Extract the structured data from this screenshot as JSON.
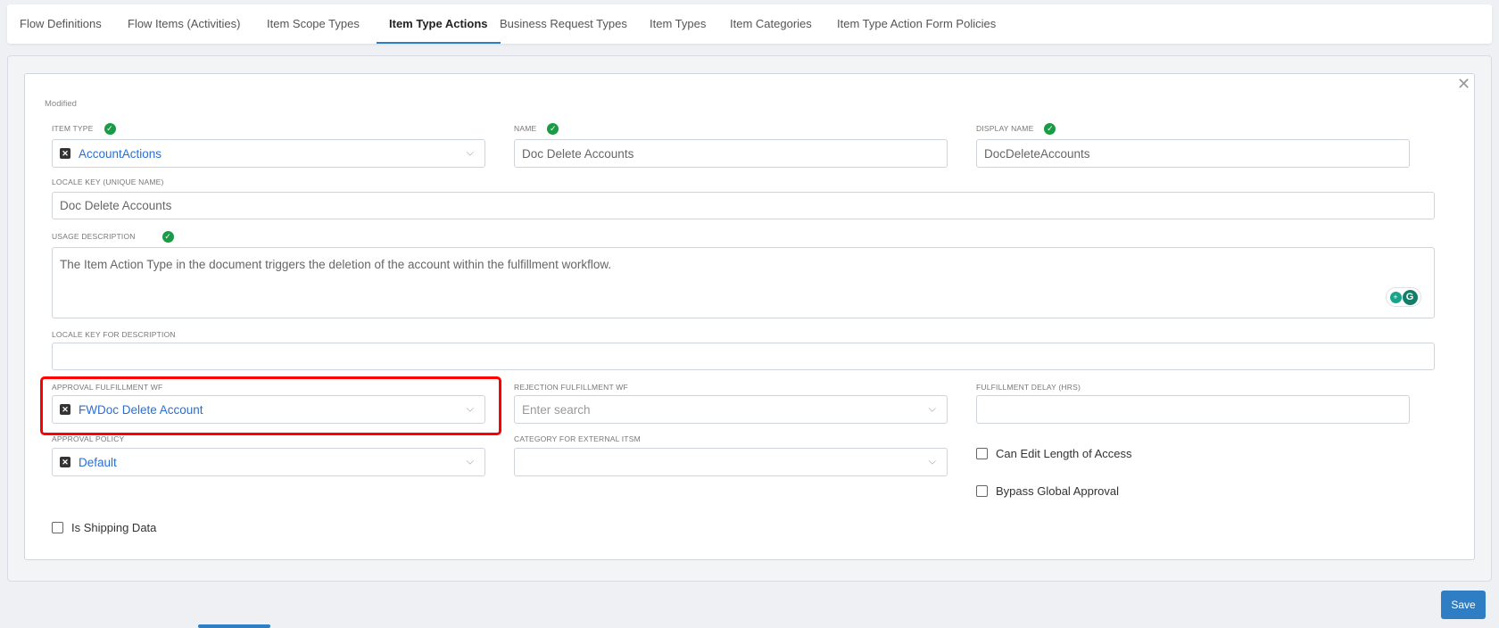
{
  "tabs": [
    "Flow Definitions",
    "Flow Items (Activities)",
    "Item Scope Types",
    "Item Type Actions",
    "Business Request Types",
    "Item Types",
    "Item Categories",
    "Item Type Action Form Policies"
  ],
  "active_tab": "Item Type Actions",
  "form": {
    "status": "Modified",
    "item_type": {
      "label": "ITEM TYPE",
      "value": "AccountActions"
    },
    "name": {
      "label": "NAME",
      "value": "Doc Delete Accounts"
    },
    "display_name": {
      "label": "DISPLAY NAME",
      "value": "DocDeleteAccounts"
    },
    "locale_key": {
      "label": "LOCALE KEY (UNIQUE NAME)",
      "value": "Doc Delete Accounts"
    },
    "usage_description": {
      "label": "USAGE DESCRIPTION",
      "value": "The Item Action Type in the document triggers the deletion of the account within the fulfillment workflow."
    },
    "locale_key_description": {
      "label": "LOCALE KEY FOR DESCRIPTION",
      "value": ""
    },
    "approval_wf": {
      "label": "APPROVAL FULFILLMENT WF",
      "value": "FWDoc Delete Account"
    },
    "rejection_wf": {
      "label": "REJECTION FULFILLMENT WF",
      "placeholder": "Enter search"
    },
    "fulfillment_delay": {
      "label": "FULFILLMENT DELAY (HRS)",
      "value": ""
    },
    "approval_policy": {
      "label": "APPROVAL POLICY",
      "value": "Default"
    },
    "category_itsm": {
      "label": "CATEGORY FOR EXTERNAL ITSM",
      "value": ""
    },
    "can_edit_length": {
      "label": "Can Edit Length of Access",
      "checked": false
    },
    "bypass_global": {
      "label": "Bypass Global Approval",
      "checked": false
    },
    "is_shipping": {
      "label": "Is Shipping Data",
      "checked": false
    }
  },
  "save_label": "Save",
  "colors": {
    "accent": "#2f7ec3",
    "highlight": "#ff0000",
    "valid": "#1a9b46"
  }
}
